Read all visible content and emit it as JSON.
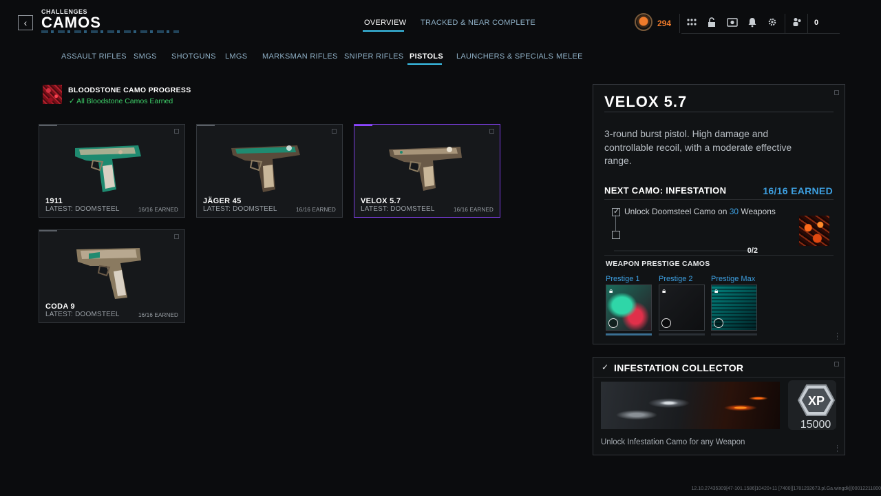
{
  "header": {
    "breadcrumb": "CHALLENGES",
    "title": "CAMOS",
    "tabs": [
      {
        "label": "OVERVIEW",
        "active": true
      },
      {
        "label": "TRACKED & NEAR COMPLETE",
        "active": false
      }
    ],
    "currency": "294",
    "icons": [
      "grid-icon",
      "unlock-icon",
      "camera-icon",
      "bell-icon",
      "gear-icon",
      "friends-icon"
    ],
    "friends_count": "0"
  },
  "categories": [
    {
      "label": "ASSAULT RIFLES",
      "active": false
    },
    {
      "label": "SMGS",
      "active": false
    },
    {
      "label": "SHOTGUNS",
      "active": false
    },
    {
      "label": "LMGS",
      "active": false
    },
    {
      "label": "MARKSMAN RIFLES",
      "active": false
    },
    {
      "label": "SNIPER RIFLES",
      "active": false
    },
    {
      "label": "PISTOLS",
      "active": true
    },
    {
      "label": "LAUNCHERS & SPECIALS",
      "active": false
    },
    {
      "label": "MELEE",
      "active": false
    }
  ],
  "bloodstone": {
    "title": "BLOODSTONE CAMO PROGRESS",
    "status": "All Bloodstone Camos Earned"
  },
  "weapons": [
    {
      "name": "1911",
      "latest": "LATEST: DOOMSTEEL",
      "earned": "16/16 EARNED",
      "selected": false
    },
    {
      "name": "JÄGER 45",
      "latest": "LATEST: DOOMSTEEL",
      "earned": "16/16 EARNED",
      "selected": false
    },
    {
      "name": "VELOX 5.7",
      "latest": "LATEST: DOOMSTEEL",
      "earned": "16/16 EARNED",
      "selected": true
    },
    {
      "name": "CODA 9",
      "latest": "LATEST: DOOMSTEEL",
      "earned": "16/16 EARNED",
      "selected": false
    }
  ],
  "detail": {
    "title": "VELOX 5.7",
    "description": "3-round burst pistol. High damage and controllable recoil, with a moderate effective range.",
    "next_camo": "NEXT CAMO: INFESTATION",
    "earned": "16/16 EARNED",
    "objective_prefix": "Unlock Doomsteel Camo on ",
    "objective_count": "30",
    "objective_suffix": " Weapons",
    "progress_text": "0/2",
    "prestige_heading": "WEAPON PRESTIGE CAMOS",
    "prestige": [
      {
        "label": "Prestige 1",
        "progress": 1.0
      },
      {
        "label": "Prestige 2",
        "progress": 0.0
      },
      {
        "label": "Prestige Max",
        "progress": 0.0
      }
    ]
  },
  "collector": {
    "title": "INFESTATION COLLECTOR",
    "xp_label": "XP",
    "xp_value": "15000",
    "description": "Unlock Infestation Camo for any Weapon"
  },
  "build_info": "12.10.27435309[47-101.1586]10420+11 [7400][1781292673.pl.Ga.wingdk][00012211800"
}
